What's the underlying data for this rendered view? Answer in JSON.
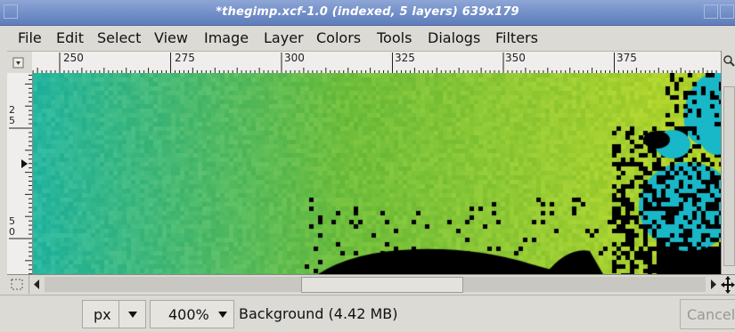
{
  "window": {
    "title": "*thegimp.xcf-1.0 (indexed, 5 layers) 639x179"
  },
  "menu": {
    "items": [
      "File",
      "Edit",
      "Select",
      "View",
      "Image",
      "Layer",
      "Colors",
      "Tools",
      "Dialogs",
      "Filters"
    ]
  },
  "ruler": {
    "top_labels": [
      "250",
      "275",
      "300",
      "325",
      "350",
      "375"
    ],
    "left_labels": [
      "2",
      "5",
      "5",
      "0"
    ]
  },
  "statusbar": {
    "unit": "px",
    "zoom": "400%",
    "layer_info": "Background (4.42 MB)",
    "cancel_label": "Cancel"
  },
  "icons": {
    "ruler_corner": "navigate-icon",
    "zoom_corner": "zoom-icon",
    "quick_mask": "quick-mask-icon",
    "navigate": "navigate-cross-icon"
  },
  "colors": {
    "title_gradient_top": "#8ea6d6",
    "title_gradient_bottom": "#5f7dbb",
    "canvas_teal": "#27b6a0",
    "canvas_green": "#6fbe3c",
    "canvas_yellow": "#b9d72a",
    "logo_cyan": "#19b8c8",
    "logo_black": "#000000"
  }
}
